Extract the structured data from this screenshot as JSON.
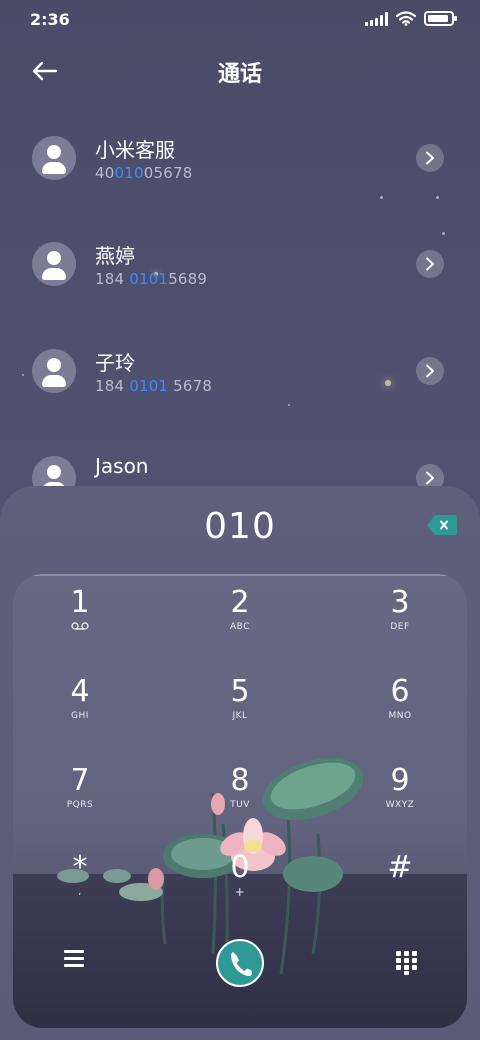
{
  "status_bar": {
    "time": "2:36",
    "battery_level": 0.9
  },
  "header": {
    "title": "通话",
    "back_icon": "arrow-left-icon"
  },
  "contacts": [
    {
      "name": "小米客服",
      "number_pre": "40",
      "number_match": "010",
      "number_post": "05678"
    },
    {
      "name": "燕婷",
      "number_pre": "184 ",
      "number_match": "0101",
      "number_post": "5689"
    },
    {
      "name": "子玲",
      "number_pre": "184 ",
      "number_match": "0101",
      "number_post": " 5678"
    },
    {
      "name": "Jason",
      "number_pre": "",
      "number_match": "",
      "number_post": ""
    }
  ],
  "dialer": {
    "input": "010",
    "keys": [
      {
        "digit": "1",
        "letters": ""
      },
      {
        "digit": "2",
        "letters": "ABC"
      },
      {
        "digit": "3",
        "letters": "DEF"
      },
      {
        "digit": "4",
        "letters": "GHI"
      },
      {
        "digit": "5",
        "letters": "JKL"
      },
      {
        "digit": "6",
        "letters": "MNO"
      },
      {
        "digit": "7",
        "letters": "PQRS"
      },
      {
        "digit": "8",
        "letters": "TUV"
      },
      {
        "digit": "9",
        "letters": "WXYZ"
      },
      {
        "digit": "*",
        "letters": ","
      },
      {
        "digit": "0",
        "letters": "+"
      },
      {
        "digit": "#",
        "letters": ""
      }
    ],
    "bottom_icons": [
      "menu-icon",
      "phone-icon",
      "keypad-grid-icon"
    ]
  },
  "colors": {
    "accent": "#3b8bff",
    "call_button": "#2f9a95",
    "backspace": "#2f9a95"
  }
}
